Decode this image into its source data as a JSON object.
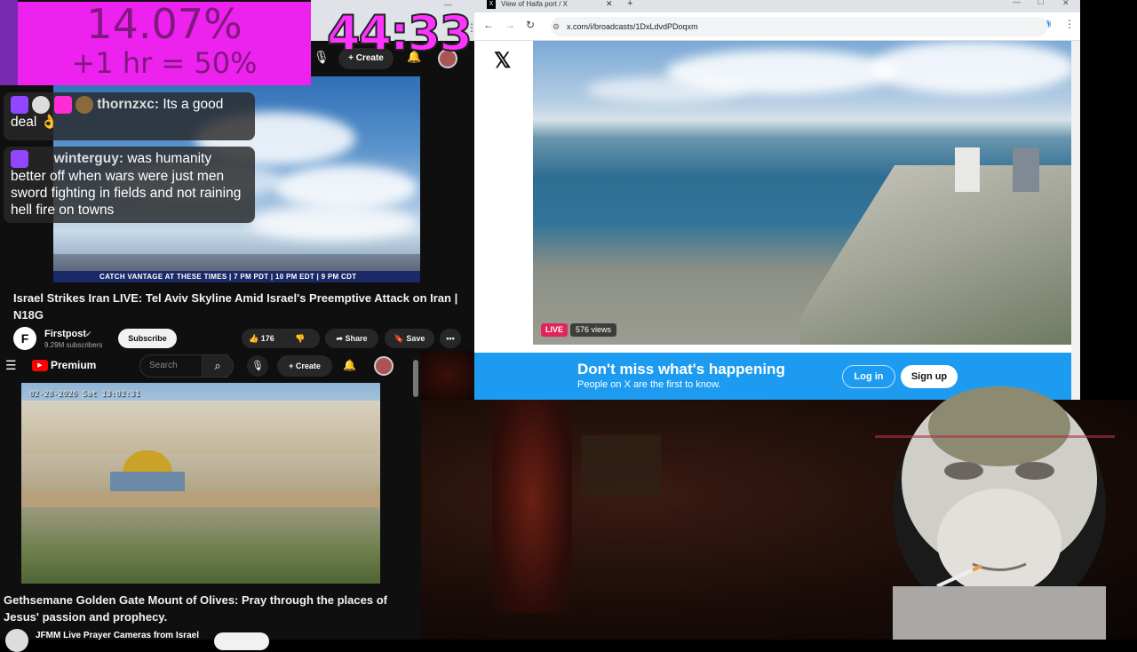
{
  "overlay": {
    "percent": "14.07%",
    "bonus": "+1 hr = 50%",
    "timer": "44:33",
    "chat": [
      {
        "user": "thornzxc:",
        "message": "Its a good",
        "message2": "deal 👌"
      },
      {
        "user": "winterguy:",
        "message": "was humanity",
        "message2": "better off when wars were just men",
        "message3": "sword fighting in fields and not raining",
        "message4": "hell fire on towns"
      }
    ]
  },
  "yt_top": {
    "create_label": "Create",
    "banner_text": "CATCH VANTAGE AT THESE TIMES | 7 PM PDT | 10 PM EDT | 9 PM CDT",
    "title": "Israel Strikes Iran LIVE: Tel Aviv Skyline Amid Israel's Preemptive Attack on Iran | N18G",
    "channel": "Firstpost",
    "subscribers": "9.29M subscribers",
    "subscribe_label": "Subscribe",
    "likes": "176",
    "share_label": "Share",
    "save_label": "Save"
  },
  "yt_bottom": {
    "brand": "Premium",
    "search_placeholder": "Search",
    "create_label": "Create",
    "timestamp": "02-28-2026 Sat 13:02:31",
    "title": "Gethsemane Golden Gate Mount of Olives: Pray through the places of Jesus' passion and prophecy.",
    "channel": "JFMM Live Prayer Cameras from Israel"
  },
  "x_window": {
    "tab_title": "View of Haifa port / X",
    "url": "x.com/i/broadcasts/1DxLdvdPDoqxm",
    "live_label": "LIVE",
    "views": "576 views",
    "banner_title": "Don't miss what's happening",
    "banner_subtitle": "People on X are the first to know.",
    "login_label": "Log in",
    "signup_label": "Sign up"
  },
  "colors": {
    "yt_red": "#ff0000",
    "x_blue": "#1d9bf0",
    "overlay_pink": "#ee22ee",
    "twitch_purple": "#9146ff"
  }
}
